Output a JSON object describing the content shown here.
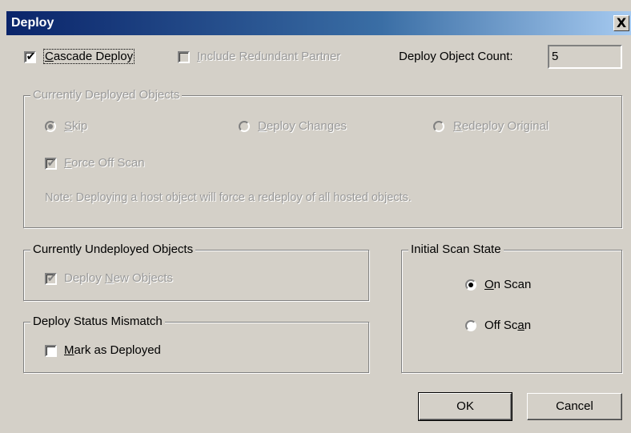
{
  "window": {
    "title": "Deploy",
    "close_glyph": "X"
  },
  "top": {
    "cascade_deploy": {
      "label_pre": "",
      "label_u": "C",
      "label_post": "ascade Deploy",
      "checked": true
    },
    "include_redundant": {
      "label_pre": "",
      "label_u": "I",
      "label_post": "nclude Redundant Partner",
      "checked": false,
      "disabled": true
    },
    "deploy_count_label": "Deploy Object Count:",
    "deploy_count_value": "5"
  },
  "deployed_group": {
    "title": "Currently Deployed Objects",
    "skip": {
      "label_pre": "",
      "label_u": "S",
      "label_post": "kip",
      "selected": true
    },
    "deploy_changes": {
      "label_pre": "",
      "label_u": "D",
      "label_post": "eploy Changes",
      "selected": false
    },
    "redeploy_original": {
      "label_pre": "",
      "label_u": "R",
      "label_post": "edeploy Original",
      "selected": false
    },
    "force_off_scan": {
      "label_pre": "",
      "label_u": "F",
      "label_post": "orce Off Scan",
      "checked": true
    },
    "note": "Note: Deploying a host object will force a redeploy of all hosted objects."
  },
  "undeployed_group": {
    "title": "Currently Undeployed Objects",
    "deploy_new": {
      "label_pre": "Deploy ",
      "label_u": "N",
      "label_post": "ew Objects",
      "checked": true
    }
  },
  "mismatch_group": {
    "title": "Deploy Status Mismatch",
    "mark_deployed": {
      "label_pre": "",
      "label_u": "M",
      "label_post": "ark as Deployed",
      "checked": false
    }
  },
  "scan_group": {
    "title": "Initial Scan State",
    "on_scan": {
      "label_pre": "",
      "label_u": "O",
      "label_post": "n Scan",
      "selected": true
    },
    "off_scan": {
      "label_pre": "Off Sc",
      "label_u": "a",
      "label_post": "n",
      "selected": false
    }
  },
  "buttons": {
    "ok": "OK",
    "cancel": "Cancel"
  },
  "glyphs": {
    "check": "✔"
  }
}
